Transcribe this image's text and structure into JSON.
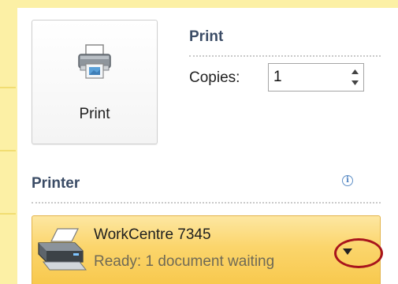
{
  "print_button": {
    "label": "Print",
    "icon": "printer-icon"
  },
  "print_section": {
    "title": "Print",
    "copies_label": "Copies:",
    "copies_value": "1"
  },
  "printer_section": {
    "title": "Printer",
    "info_icon": "info-icon",
    "selected_printer": {
      "name": "WorkCentre 7345",
      "status": "Ready: 1 document waiting",
      "icon": "printer-device-icon"
    },
    "dropdown_icon": "triangle-down-icon"
  },
  "colors": {
    "frame": "#fcf0a5",
    "heading": "#3b4c66",
    "dropdown_highlight": "#fbd56c",
    "callout": "#a8141c"
  }
}
